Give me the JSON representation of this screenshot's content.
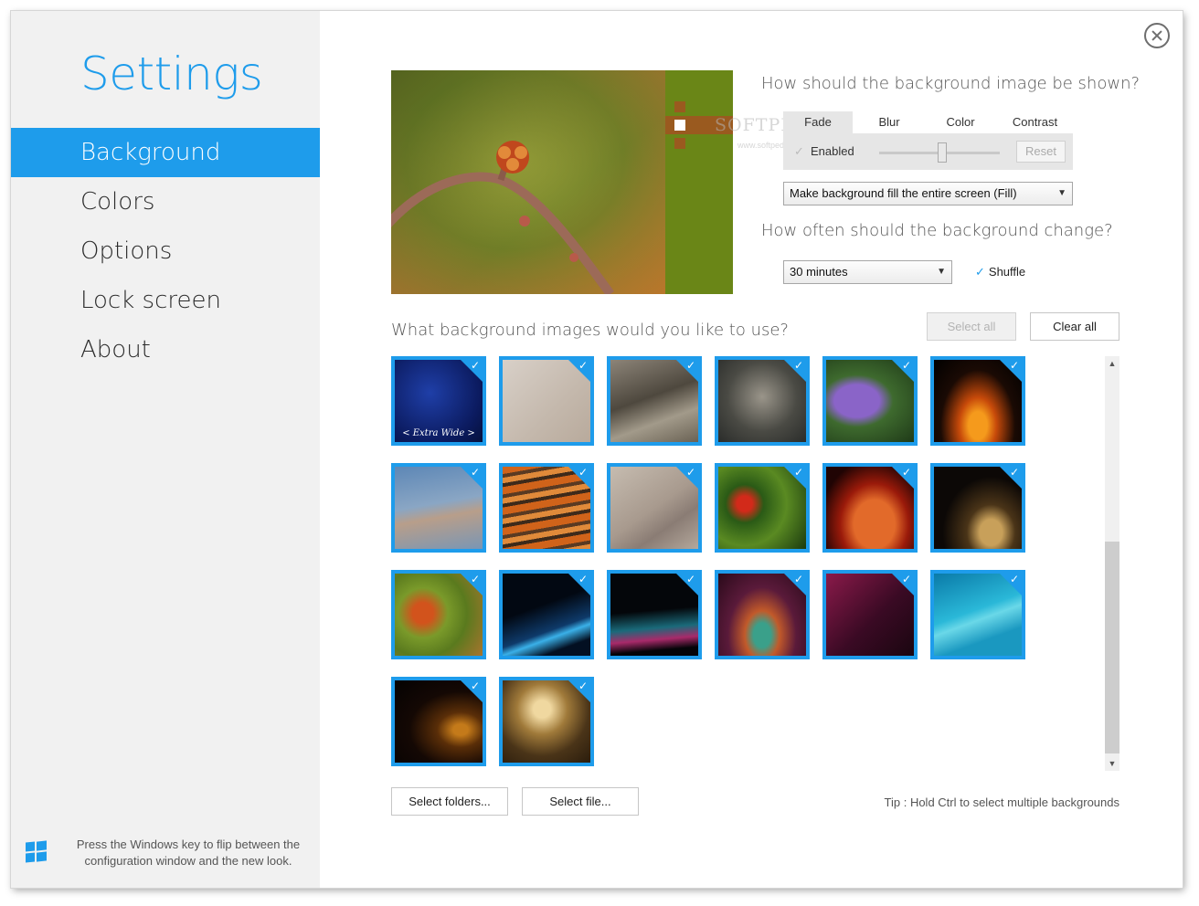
{
  "sidebar": {
    "title": "Settings",
    "items": [
      {
        "label": "Background"
      },
      {
        "label": "Colors"
      },
      {
        "label": "Options"
      },
      {
        "label": "Lock screen"
      },
      {
        "label": "About"
      }
    ],
    "hint": "Press the Windows key to flip between the configuration window and the new look."
  },
  "background": {
    "question_shown": "How should the background image be shown?",
    "tabs": [
      {
        "label": "Fade"
      },
      {
        "label": "Blur"
      },
      {
        "label": "Color"
      },
      {
        "label": "Contrast"
      }
    ],
    "enabled_label": "Enabled",
    "reset_label": "Reset",
    "fill_mode": "Make background fill the entire screen (Fill)",
    "question_change": "How often should the background change?",
    "interval": "30 minutes",
    "shuffle_label": "Shuffle",
    "question_images": "What background images would you like to use?",
    "select_all_label": "Select all",
    "clear_all_label": "Clear all",
    "select_folders_label": "Select folders...",
    "select_file_label": "Select file...",
    "tip": "Tip : Hold Ctrl to select multiple backgrounds",
    "first_thumb_caption": "< Extra Wide >"
  },
  "watermark": {
    "text": "SOFTPEDIA",
    "sub": "www.softpedia.com"
  },
  "colors": {
    "accent": "#1e9ceb",
    "sidebar_bg": "#f1f1f1"
  }
}
